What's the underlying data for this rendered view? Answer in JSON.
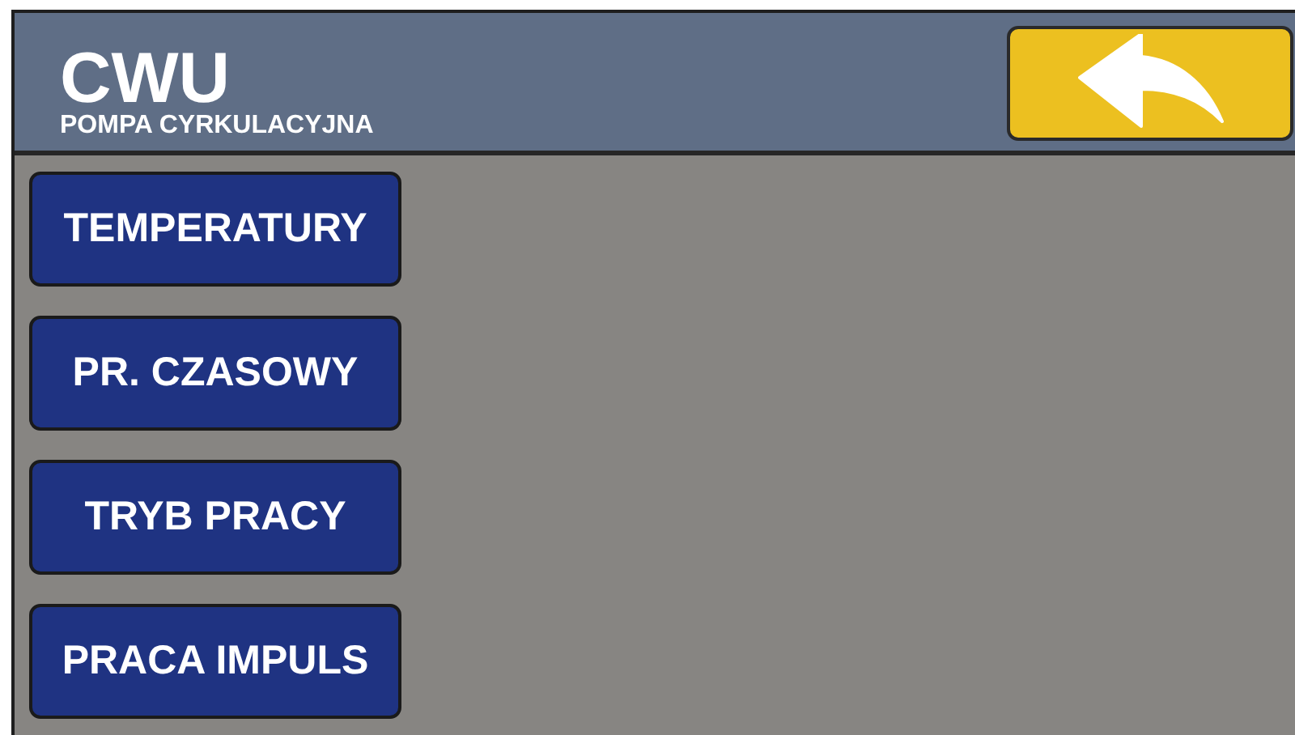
{
  "header": {
    "title": "CWU",
    "subtitle": "POMPA CYRKULACYJNA"
  },
  "menu": [
    {
      "label": "TEMPERATURY"
    },
    {
      "label": "PR. CZASOWY"
    },
    {
      "label": "TRYB PRACY"
    },
    {
      "label": "PRACA IMPULS"
    }
  ]
}
